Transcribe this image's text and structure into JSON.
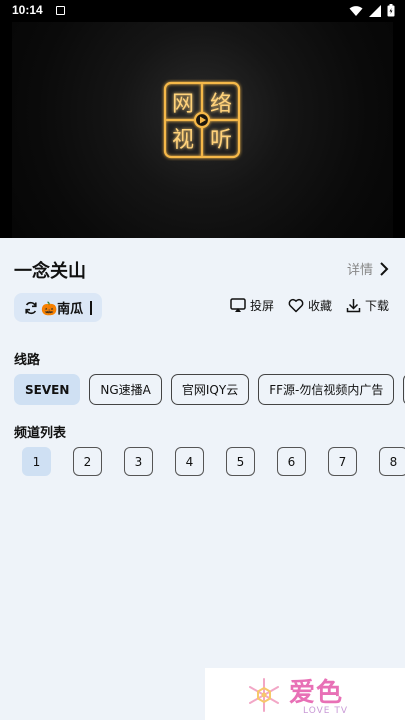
{
  "status_bar": {
    "time": "10:14"
  },
  "video": {
    "logo_text": [
      "网",
      "络",
      "视",
      "听"
    ]
  },
  "show": {
    "title": "一念关山",
    "detail_label": "详情"
  },
  "source": {
    "name": "🎃南瓜"
  },
  "actions": [
    {
      "icon": "cast-icon",
      "label": "投屏"
    },
    {
      "icon": "heart-icon",
      "label": "收藏"
    },
    {
      "icon": "download-icon",
      "label": "下载"
    }
  ],
  "routes_section": {
    "label": "线路",
    "items": [
      "SEVEN",
      "NG速播A",
      "官网IQY云",
      "FF源-勿信视频内广告"
    ],
    "active_index": 0
  },
  "channels_section": {
    "label": "频道列表",
    "items": [
      "1",
      "2",
      "3",
      "4",
      "5",
      "6",
      "7",
      "8"
    ],
    "active_index": 0
  },
  "brand": {
    "name": "爱色",
    "sub": "LOVE TV"
  },
  "colors": {
    "accent": "#cfe0f3",
    "background": "#eef3f9",
    "brand_pink": "#e870b6"
  }
}
